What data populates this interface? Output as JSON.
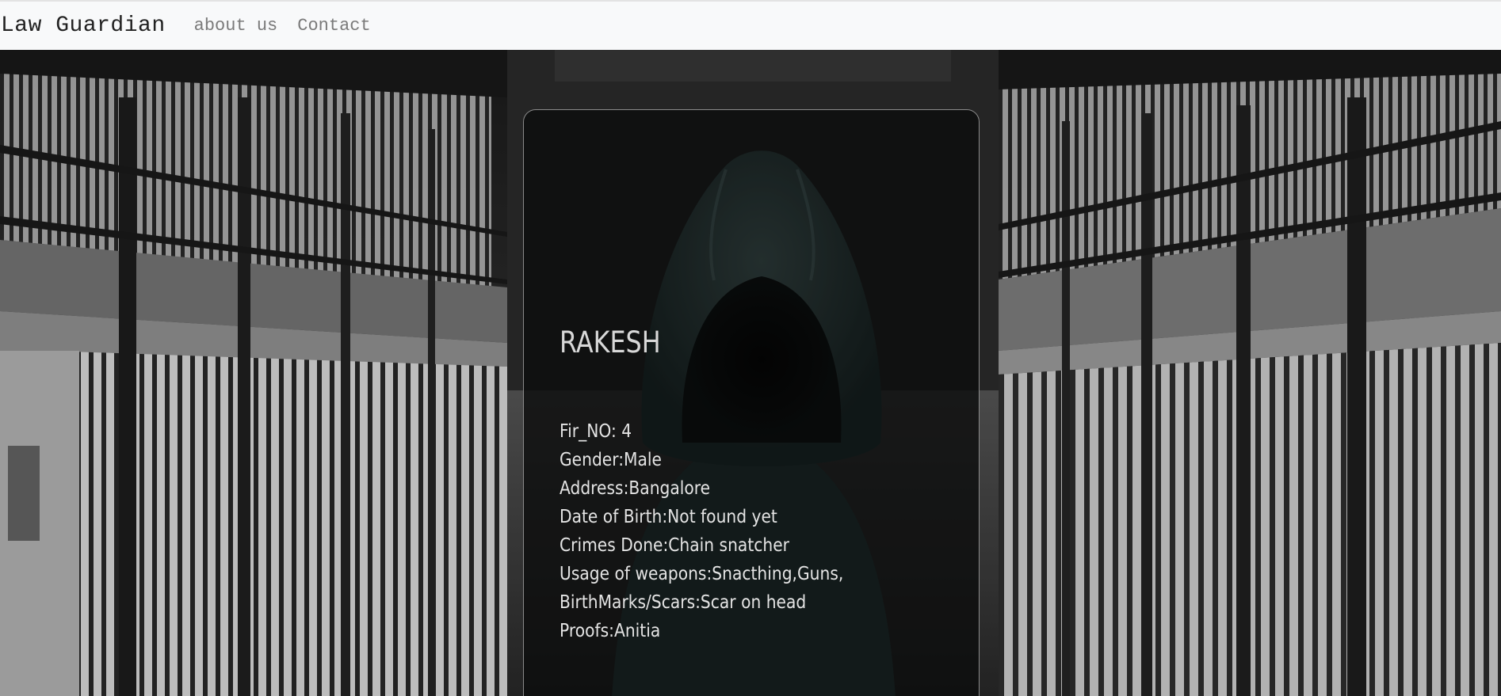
{
  "navbar": {
    "brand": "Law Guardian",
    "links": [
      {
        "label": "about us"
      },
      {
        "label": "Contact"
      }
    ]
  },
  "background": {
    "scene": "prison-corridor"
  },
  "profile": {
    "name": "RAKESH",
    "image": "hooded-figure",
    "details": [
      "Fir_NO: 4",
      "Gender:Male",
      "Address:Bangalore",
      "Date of Birth:Not found yet",
      "Crimes Done:Chain snatcher",
      "Usage of weapons:Snacthing,Guns,",
      "BirthMarks/Scars:Scar on head",
      "Proofs:Anitia"
    ]
  },
  "colors": {
    "navbar_bg": "#f8f9fa",
    "card_bg": "#121414",
    "text": "#e4e4e4"
  }
}
